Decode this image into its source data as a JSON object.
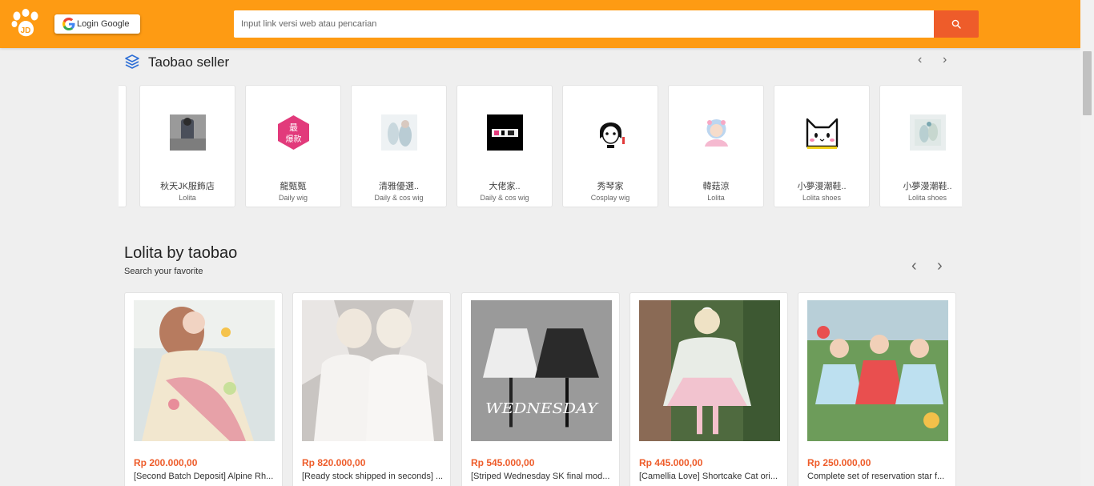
{
  "header": {
    "login_label": "Login Google",
    "search_placeholder": "Input link versi web atau pencarian",
    "colors": {
      "bar": "#fe9b13",
      "search_button": "#ee5c2a"
    }
  },
  "seller_section": {
    "title": "Taobao seller",
    "prev": "‹",
    "next": "›",
    "sellers": [
      {
        "name": "秋天JK服飾店",
        "category": "Lolita"
      },
      {
        "name": "龍甄甄",
        "category": "Daily wig"
      },
      {
        "name": "清雅優選..",
        "category": "Daily & cos wig"
      },
      {
        "name": "大佬家..",
        "category": "Daily & cos wig"
      },
      {
        "name": "秀琴家",
        "category": "Cosplay wig"
      },
      {
        "name": "韓菇涼",
        "category": "Lolita"
      },
      {
        "name": "小夢漫潮鞋..",
        "category": "Lolita shoes"
      },
      {
        "name": "小夢漫潮鞋..",
        "category": "Lolita shoes"
      }
    ],
    "logo_badge_text": "最\n爆款"
  },
  "lolita_section": {
    "title": "Lolita by taobao",
    "subtitle": "Search your favorite",
    "prev": "‹",
    "next": "›",
    "products": [
      {
        "price": "Rp 200.000,00",
        "title": "[Second Batch Deposit] Alpine Rh..."
      },
      {
        "price": "Rp 820.000,00",
        "title": "[Ready stock shipped in seconds] ..."
      },
      {
        "price": "Rp 545.000,00",
        "title": "[Striped Wednesday SK final mod..."
      },
      {
        "price": "Rp 445.000,00",
        "title": "[Camellia Love] Shortcake Cat ori..."
      },
      {
        "price": "Rp 250.000,00",
        "title": "Complete set of reservation star f..."
      }
    ],
    "wednesday_text": "WEDNESDAY"
  }
}
